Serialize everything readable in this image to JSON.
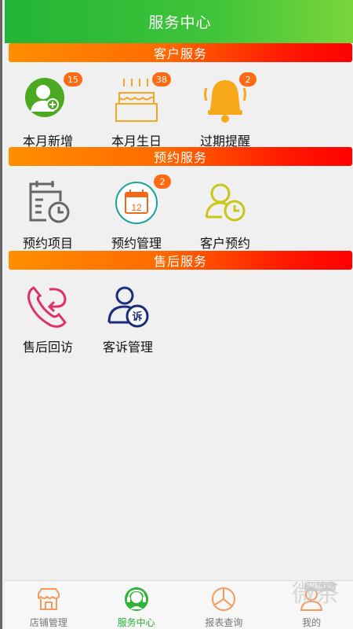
{
  "header": {
    "title": "服务中心"
  },
  "sections": {
    "customer": {
      "title": "客户服务"
    },
    "booking": {
      "title": "预约服务"
    },
    "aftersales": {
      "title": "售后服务"
    }
  },
  "tiles": {
    "new_this_month": {
      "label": "本月新增",
      "badge": "15"
    },
    "birthday_this_month": {
      "label": "本月生日",
      "badge": "38"
    },
    "expiry_reminder": {
      "label": "过期提醒",
      "badge": "2"
    },
    "booking_items": {
      "label": "预约项目"
    },
    "booking_manage": {
      "label": "预约管理",
      "badge": "2",
      "calendar_day": "12"
    },
    "customer_booking": {
      "label": "客户预约"
    },
    "followup": {
      "label": "售后回访"
    },
    "complaints": {
      "label": "客诉管理",
      "icon_char": "诉"
    }
  },
  "tabbar": {
    "items": [
      {
        "label": "店铺管理",
        "icon": "store-icon"
      },
      {
        "label": "服务中心",
        "icon": "headset-icon"
      },
      {
        "label": "报表查询",
        "icon": "chart-icon"
      },
      {
        "label": "我的",
        "icon": "user-icon"
      }
    ],
    "active_index": 1
  },
  "watermark": {
    "text": "微茶",
    "small": "WXCHA"
  },
  "colors": {
    "header_green": "#22b436",
    "section_orange": "#ff8e00",
    "section_red": "#ff0000",
    "badge": "#ff6a14",
    "tab_active": "#29b036"
  }
}
